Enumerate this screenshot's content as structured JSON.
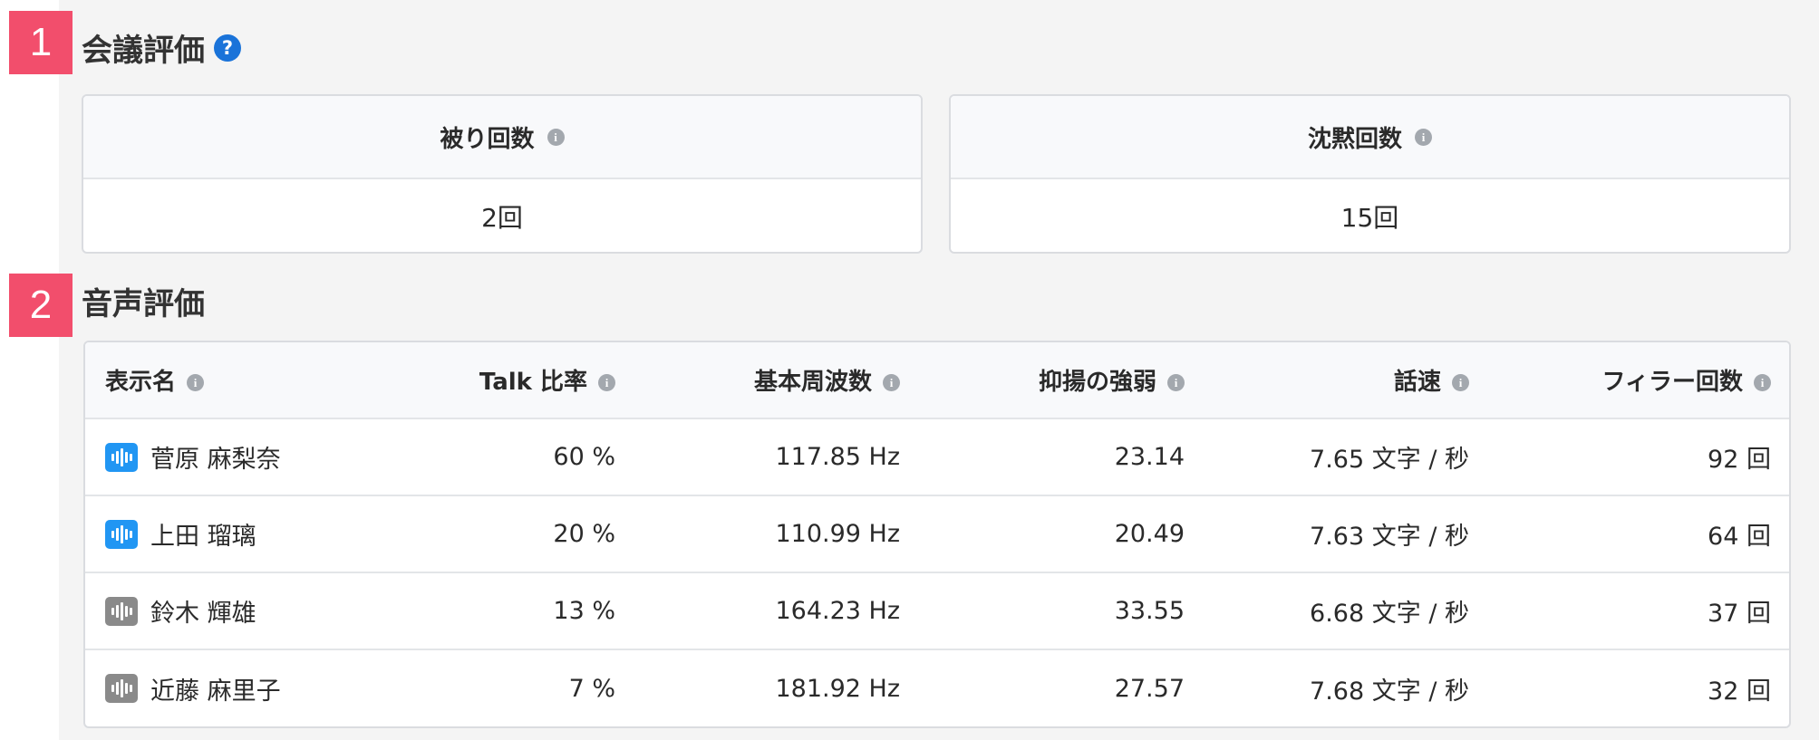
{
  "colors": {
    "marker": "#f24e6c",
    "help": "#1a73d9",
    "active_speaker": "#2196f3",
    "inactive_speaker": "#8a8a8a"
  },
  "sections": {
    "meeting": {
      "number": "1",
      "title": "会議評価",
      "help_icon": "question-circle-icon"
    },
    "voice": {
      "number": "2",
      "title": "音声評価"
    }
  },
  "cards": [
    {
      "label": "被り回数",
      "value": "2回"
    },
    {
      "label": "沈黙回数",
      "value": "15回"
    }
  ],
  "table": {
    "headers": [
      "表示名",
      "Talk 比率",
      "基本周波数",
      "抑揚の強弱",
      "話速",
      "フィラー回数"
    ],
    "rows": [
      {
        "name": "菅原 麻梨奈",
        "active": true,
        "talk": "60 %",
        "freq": "117.85 Hz",
        "intonation": "23.14",
        "speed": "7.65 文字 / 秒",
        "filler": "92 回"
      },
      {
        "name": "上田 瑠璃",
        "active": true,
        "talk": "20 %",
        "freq": "110.99 Hz",
        "intonation": "20.49",
        "speed": "7.63 文字 / 秒",
        "filler": "64 回"
      },
      {
        "name": "鈴木 輝雄",
        "active": false,
        "talk": "13 %",
        "freq": "164.23 Hz",
        "intonation": "33.55",
        "speed": "6.68 文字 / 秒",
        "filler": "37 回"
      },
      {
        "name": "近藤 麻里子",
        "active": false,
        "talk": "7 %",
        "freq": "181.92 Hz",
        "intonation": "27.57",
        "speed": "7.68 文字 / 秒",
        "filler": "32 回"
      }
    ]
  }
}
